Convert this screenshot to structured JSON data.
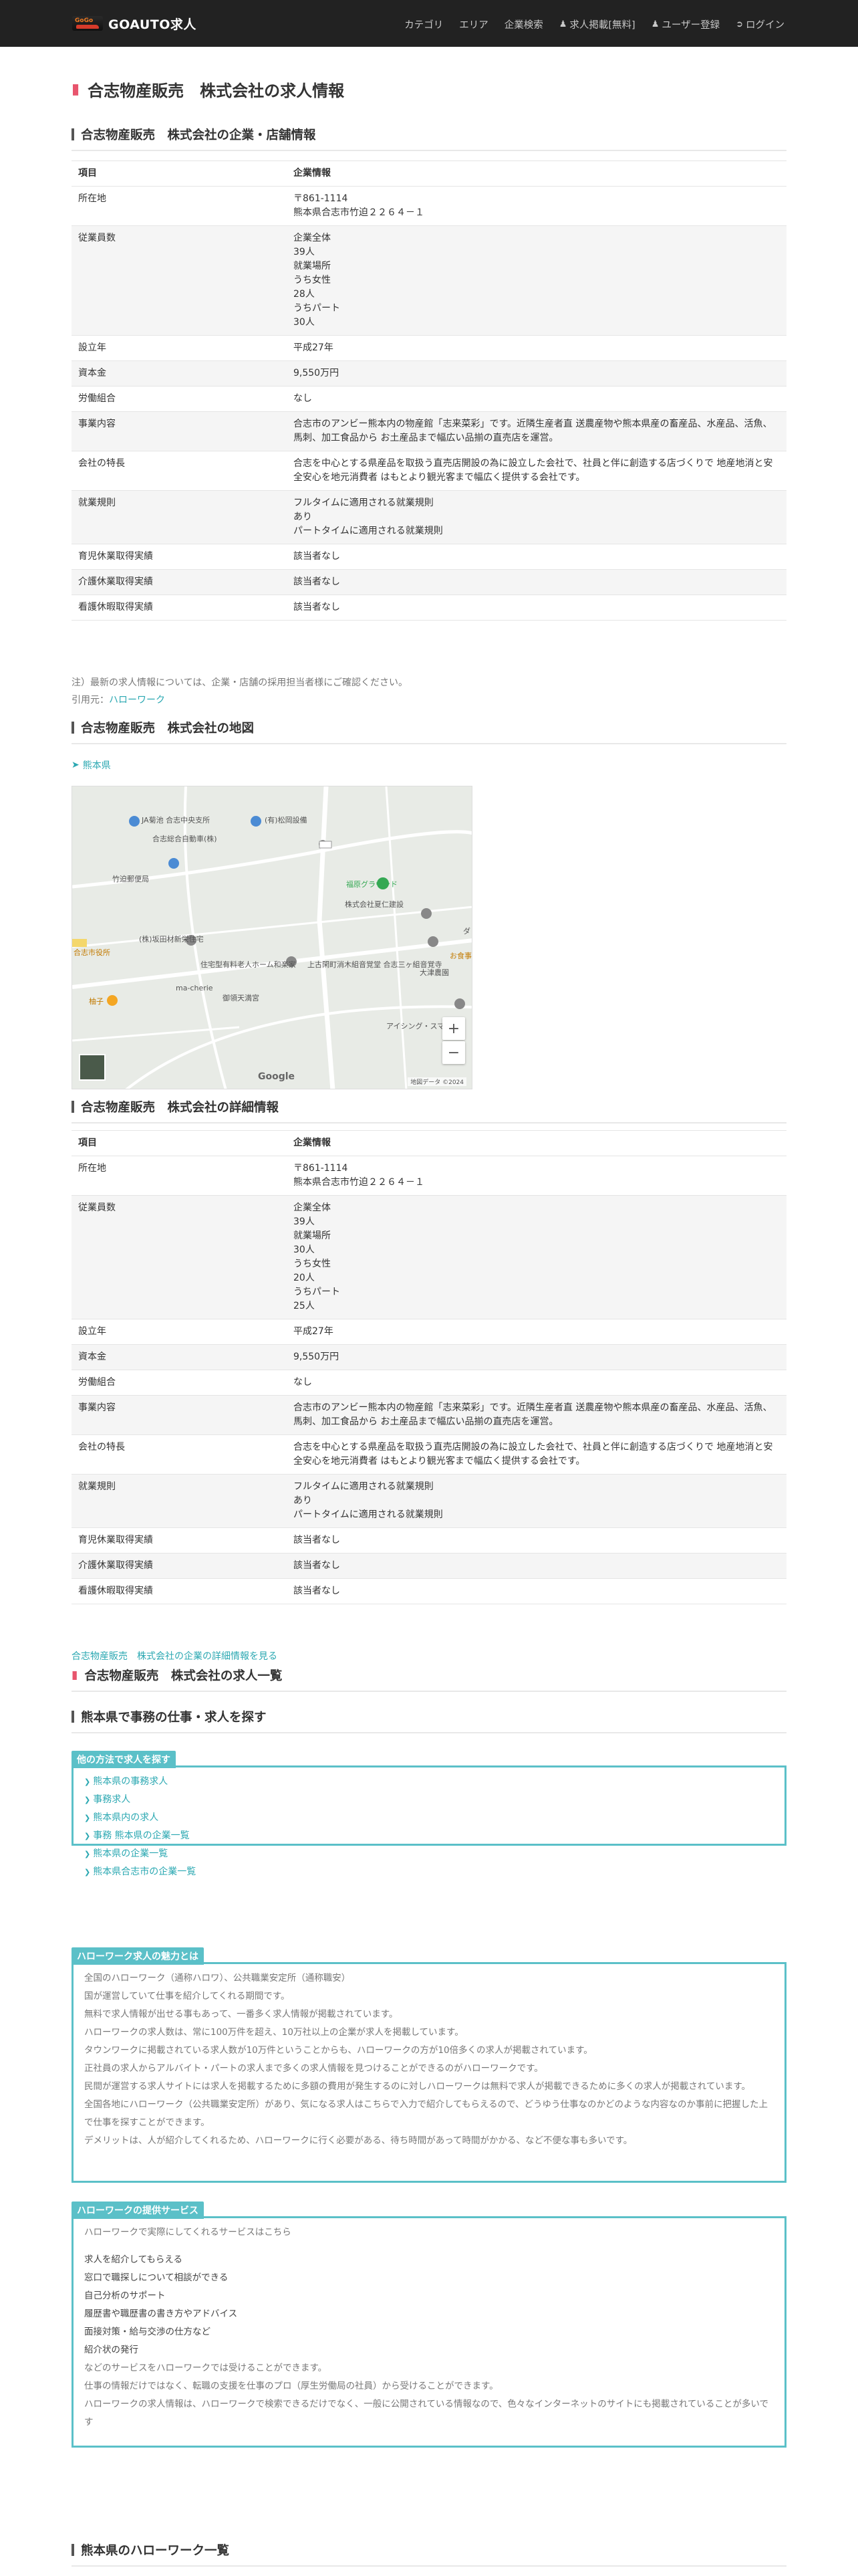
{
  "header": {
    "brand_mark": "GoGo",
    "brand": "GOAUTO求人",
    "nav": [
      {
        "label": "カテゴリ",
        "icon": ""
      },
      {
        "label": "エリア",
        "icon": ""
      },
      {
        "label": "企業検索",
        "icon": ""
      },
      {
        "label": "求人掲載[無料]",
        "icon": "user-icon"
      },
      {
        "label": "ユーザー登録",
        "icon": "user-icon"
      },
      {
        "label": "ログイン",
        "icon": "login-icon"
      }
    ]
  },
  "page_title": "合志物産販売　株式会社の求人情報",
  "section_company": "合志物産販売　株式会社の企業・店舗情報",
  "table1": {
    "head": [
      "項目",
      "企業情報"
    ],
    "rows": [
      {
        "k": "所在地",
        "v": "〒861-1114\n熊本県合志市竹迫２２６４－１"
      },
      {
        "k": "従業員数",
        "v": "企業全体\n39人\n就業場所\nうち女性\n28人\nうちパート\n30人"
      },
      {
        "k": "設立年",
        "v": "平成27年"
      },
      {
        "k": "資本金",
        "v": "9,550万円"
      },
      {
        "k": "労働組合",
        "v": "なし"
      },
      {
        "k": "事業内容",
        "v": "合志市のアンビー熊本内の物産館「志来菜彩」です。近隣生産者直 送農産物や熊本県産の畜産品、水産品、活魚、馬刺、加工食品から お土産品まで幅広い品揃の直売店を運営。"
      },
      {
        "k": "会社の特長",
        "v": "合志を中心とする県産品を取扱う直売店開設の為に設立した会社で、社員と伴に創造する店づくりで 地産地消と安全安心を地元消費者 はもとより観光客まで幅広く提供する会社です。"
      },
      {
        "k": "就業規則",
        "v": "フルタイムに適用される就業規則\nあり\nパートタイムに適用される就業規則"
      },
      {
        "k": "育児休業取得実績",
        "v": "該当者なし"
      },
      {
        "k": "介護休業取得実績",
        "v": "該当者なし"
      },
      {
        "k": "看護休暇取得実績",
        "v": "該当者なし"
      }
    ]
  },
  "note": "注）最新の求人情報については、企業・店舗の採用担当者様にご確認ください。",
  "source_label": "引用元：",
  "source_link": "ハローワーク",
  "section_map": "合志物産販売　株式会社の地図",
  "map": {
    "pin_label": "熊本県",
    "labels": [
      "JA菊池 合志中央支所",
      "(有)松岡設備",
      "合志総合自動車(株)",
      "竹迫郵便局",
      "福原グラウンド",
      "株式会社夏仁建設",
      "(株)坂田材新栄住宅",
      "住宅型有料老人ホーム和楽家",
      "上古閑町消木組音覚堂 合志三ヶ組音覚寺",
      "大津農園",
      "御領天満宮",
      "ma-cherie",
      "アイシング・スマイル",
      "柚子",
      "合志市役所",
      "お食事",
      "ダ"
    ],
    "attribution": "Google",
    "copyright": "地図データ ©2024"
  },
  "section_detail": "合志物産販売　株式会社の詳細情報",
  "table2": {
    "head": [
      "項目",
      "企業情報"
    ],
    "rows": [
      {
        "k": "所在地",
        "v": "〒861-1114\n熊本県合志市竹迫２２６４－１"
      },
      {
        "k": "従業員数",
        "v": "企業全体\n39人\n就業場所\n30人\nうち女性\n20人\nうちパート\n25人"
      },
      {
        "k": "設立年",
        "v": "平成27年"
      },
      {
        "k": "資本金",
        "v": "9,550万円"
      },
      {
        "k": "労働組合",
        "v": "なし"
      },
      {
        "k": "事業内容",
        "v": "合志市のアンビー熊本内の物産館「志来菜彩」です。近隣生産者直 送農産物や熊本県産の畜産品、水産品、活魚、馬刺、加工食品から お土産品まで幅広い品揃の直売店を運営。"
      },
      {
        "k": "会社の特長",
        "v": "合志を中心とする県産品を取扱う直売店開設の為に設立した会社で、社員と伴に創造する店づくりで 地産地消と安全安心を地元消費者 はもとより観光客まで幅広く提供する会社です。"
      },
      {
        "k": "就業規則",
        "v": "フルタイムに適用される就業規則\nあり\nパートタイムに適用される就業規則"
      },
      {
        "k": "育児休業取得実績",
        "v": "該当者なし"
      },
      {
        "k": "介護休業取得実績",
        "v": "該当者なし"
      },
      {
        "k": "看護休暇取得実績",
        "v": "該当者なし"
      }
    ]
  },
  "detail_link": "合志物産販売　株式会社の企業の詳細情報を見る",
  "section_jobs": "合志物産販売　株式会社の求人一覧",
  "section_search": "熊本県で事務の仕事・求人を探す",
  "other_ways": {
    "tag": "他の方法で求人を探す",
    "links": [
      "熊本県の事務求人",
      "事務求人",
      "熊本県内の求人",
      "事務 熊本県の企業一覧",
      "熊本県の企業一覧",
      "熊本県合志市の企業一覧"
    ]
  },
  "appeal": {
    "tag": "ハローワーク求人の魅力とは",
    "lines": [
      "全国のハローワーク（通称ハロワ）、公共職業安定所（通称職安）",
      "国が運営していて仕事を紹介してくれる期間です。",
      "無料で求人情報が出せる事もあって、一番多く求人情報が掲載されています。",
      "ハローワークの求人数は、常に100万件を超え、10万社以上の企業が求人を掲載しています。",
      "タウンワークに掲載されている求人数が10万件ということからも、ハローワークの方が10倍多くの求人が掲載されています。",
      "正社員の求人からアルバイト・パートの求人まで多くの求人情報を見つけることができるのがハローワークです。",
      "民間が運営する求人サイトには求人を掲載するために多額の費用が発生するのに対しハローワークは無料で求人が掲載できるために多くの求人が掲載されています。",
      "全国各地にハローワーク（公共職業安定所）があり、気になる求人はこちらで入力で紹介してもらえるので、どうゆう仕事なのかどのような内容なのか事前に把握した上で仕事を探すことができます。",
      "デメリットは、人が紹介してくれるため、ハローワークに行く必要がある、待ち時間があって時間がかかる、など不便な事も多いです。"
    ]
  },
  "services": {
    "tag": "ハローワークの提供サービス",
    "intro": "ハローワークで実際にしてくれるサービスはこちら",
    "items": [
      "求人を紹介してもらえる",
      "窓口で職探しについて相談ができる",
      "自己分析のサポート",
      "履歴書や職歴書の書き方やアドバイス",
      "面接対策・給与交渉の仕方など",
      "紹介状の発行"
    ],
    "outro": [
      "などのサービスをハローワークでは受けることができます。",
      "仕事の情報だけではなく、転職の支援を仕事のプロ（厚生労働局の社員）から受けることができます。",
      "ハローワークの求人情報は、ハローワークで検索できるだけでなく、一般に公開されている情報なので、色々なインターネットのサイトにも掲載されていることが多いです"
    ]
  },
  "section_hw": "熊本県のハローワーク一覧"
}
